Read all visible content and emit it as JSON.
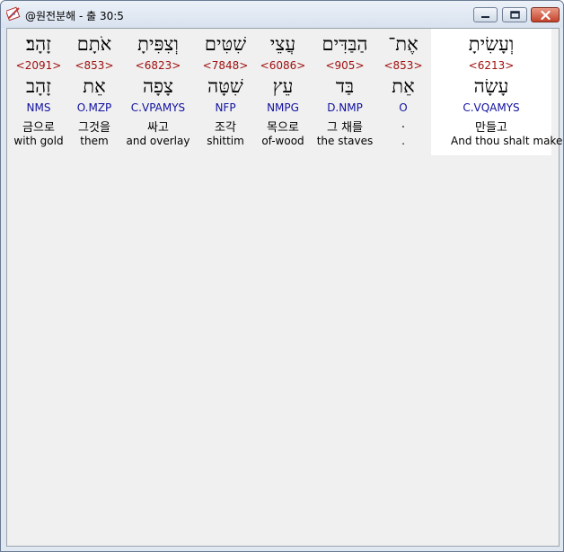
{
  "window": {
    "title": "@원전분해 - 출 30:5",
    "buttons": {
      "minimize": "minimize",
      "maximize": "maximize",
      "close": "close"
    }
  },
  "colors": {
    "strong": "#a01010",
    "morph": "#1010a0",
    "text": "#000000",
    "selected_bg": "#ffffff",
    "panel_bg": "#f0f0f0"
  },
  "words": [
    {
      "heb": "וְעָשִׂיתָ",
      "strong": "<6213>",
      "lemma": "עָשָׂה",
      "morph": "C.VQAMYS",
      "kor": "만들고",
      "eng": "And thou shalt make"
    },
    {
      "heb": "אֶת־",
      "strong": "<853>",
      "lemma": "אֵת",
      "morph": "O",
      "kor": ".",
      "eng": "."
    },
    {
      "heb": "הַבַּדִּים",
      "strong": "<905>",
      "lemma": "בַּד",
      "morph": "D.NMP",
      "kor": "그 채를",
      "eng": "the staves"
    },
    {
      "heb": "עֲצֵי",
      "strong": "<6086>",
      "lemma": "עֵץ",
      "morph": "NMPG",
      "kor": "목으로",
      "eng": "of-wood"
    },
    {
      "heb": "שִׁטִּים",
      "strong": "<7848>",
      "lemma": "שִׁטָּה",
      "morph": "NFP",
      "kor": "조각",
      "eng": "shittim"
    },
    {
      "heb": "וְצִפִּיתָ",
      "strong": "<6823>",
      "lemma": "צָפָה",
      "morph": "C.VPAMYS",
      "kor": "싸고",
      "eng": "and overlay"
    },
    {
      "heb": "אֹתָם",
      "strong": "<853>",
      "lemma": "אֵת",
      "morph": "O.MZP",
      "kor": "그것을",
      "eng": "them"
    },
    {
      "heb": "זָהָב׃",
      "strong": "<2091>",
      "lemma": "זָהָב",
      "morph": "NMS",
      "kor": "금으로",
      "eng": "with gold"
    }
  ]
}
